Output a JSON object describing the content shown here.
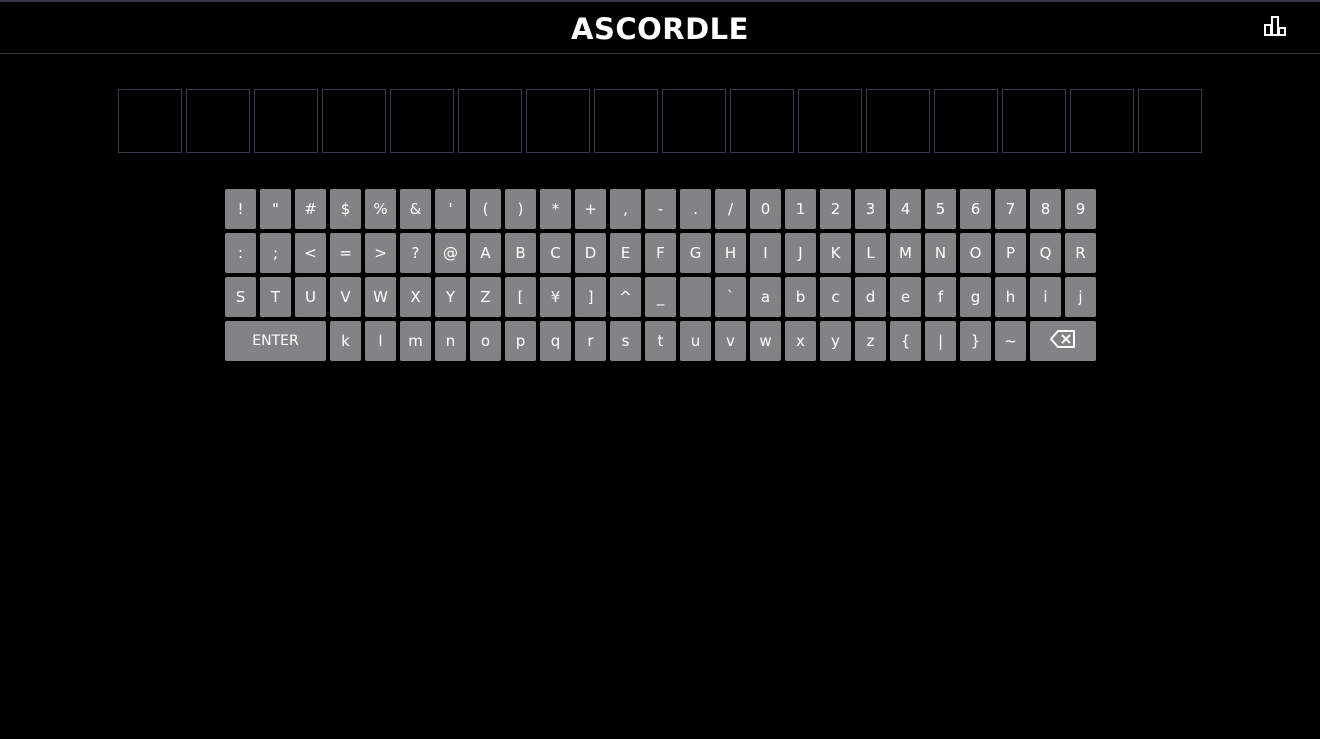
{
  "header": {
    "title": "ASCORDLE",
    "stats_icon": "stats-chart-icon"
  },
  "board": {
    "tiles": [
      "",
      "",
      "",
      "",
      "",
      "",
      "",
      "",
      "",
      "",
      "",
      "",
      "",
      "",
      "",
      ""
    ]
  },
  "keyboard": {
    "rows": [
      [
        "!",
        "\"",
        "#",
        "$",
        "%",
        "&",
        "'",
        "(",
        ")",
        "*",
        "+",
        ",",
        "-",
        ".",
        "/",
        "0",
        "1",
        "2",
        "3",
        "4",
        "5",
        "6",
        "7",
        "8",
        "9"
      ],
      [
        ":",
        ";",
        "<",
        "=",
        ">",
        "?",
        "@",
        "A",
        "B",
        "C",
        "D",
        "E",
        "F",
        "G",
        "H",
        "I",
        "J",
        "K",
        "L",
        "M",
        "N",
        "O",
        "P",
        "Q",
        "R"
      ],
      [
        "S",
        "T",
        "U",
        "V",
        "W",
        "X",
        "Y",
        "Z",
        "[",
        "¥",
        "]",
        "^",
        "_",
        " ",
        "`",
        "a",
        "b",
        "c",
        "d",
        "e",
        "f",
        "g",
        "h",
        "i",
        "j"
      ],
      [
        "ENTER",
        "k",
        "l",
        "m",
        "n",
        "o",
        "p",
        "q",
        "r",
        "s",
        "t",
        "u",
        "v",
        "w",
        "x",
        "y",
        "z",
        "{",
        "|",
        "}",
        "~",
        "⌫"
      ]
    ],
    "enter_label": "ENTER",
    "backspace_icon": "backspace-icon",
    "key_color": "#818384"
  }
}
